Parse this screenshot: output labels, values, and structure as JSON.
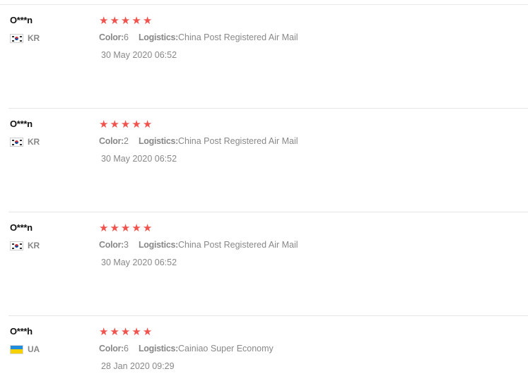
{
  "reviews": [
    {
      "user": "O***n",
      "country_code": "KR",
      "flag_icon": "kr-flag-icon",
      "rating": 5,
      "color_label": "Color:",
      "color_value": "6",
      "logistics_label": "Logistics:",
      "logistics_value": "China Post Registered Air Mail",
      "date": "30 May 2020 06:52"
    },
    {
      "user": "O***n",
      "country_code": "KR",
      "flag_icon": "kr-flag-icon",
      "rating": 5,
      "color_label": "Color:",
      "color_value": "2",
      "logistics_label": "Logistics:",
      "logistics_value": "China Post Registered Air Mail",
      "date": "30 May 2020 06:52"
    },
    {
      "user": "O***n",
      "country_code": "KR",
      "flag_icon": "kr-flag-icon",
      "rating": 5,
      "color_label": "Color:",
      "color_value": "3",
      "logistics_label": "Logistics:",
      "logistics_value": "China Post Registered Air Mail",
      "date": "30 May 2020 06:52"
    },
    {
      "user": "O***h",
      "country_code": "UA",
      "flag_icon": "ua-flag-icon",
      "rating": 5,
      "color_label": "Color:",
      "color_value": "6",
      "logistics_label": "Logistics:",
      "logistics_value": "Cainiao Super Economy",
      "date": "28 Jan 2020 09:29"
    }
  ],
  "colors": {
    "star": "#f0534d",
    "muted_text": "#888888",
    "name_text": "#111111",
    "divider": "#e6e6e6"
  }
}
